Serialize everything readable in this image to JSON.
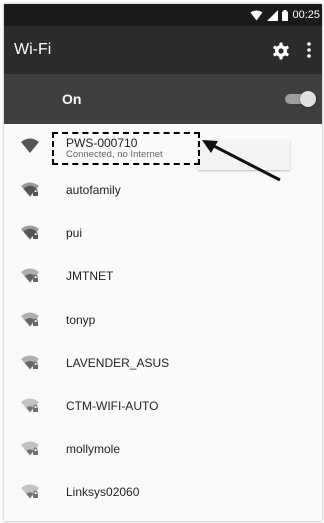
{
  "status_bar": {
    "time": "00:25"
  },
  "app_bar": {
    "title": "Wi-Fi",
    "icons": [
      "gear-icon",
      "overflow-menu-icon"
    ]
  },
  "toggle": {
    "label": "On",
    "state": "on"
  },
  "networks": [
    {
      "name": "PWS-000710",
      "status": "Connected, no Internet",
      "icon": "wifi-strong-icon"
    },
    {
      "name": "autofamily",
      "icon": "wifi-locked-icon"
    },
    {
      "name": "pui",
      "icon": "wifi-locked-icon"
    },
    {
      "name": "JMTNET",
      "icon": "wifi-locked-icon"
    },
    {
      "name": "tonyp",
      "icon": "wifi-locked-icon"
    },
    {
      "name": "LAVENDER_ASUS",
      "icon": "wifi-locked-icon"
    },
    {
      "name": "CTM-WIFI-AUTO",
      "icon": "wifi-locked-icon"
    },
    {
      "name": "mollymole",
      "icon": "wifi-locked-icon"
    },
    {
      "name": "Linksys02060",
      "icon": "wifi-locked-icon"
    }
  ],
  "colors": {
    "status_bar": "#1a1a1a",
    "app_bar": "#2b2b2b",
    "toggle_row": "#3f3f3f",
    "list_bg": "#fafafa"
  }
}
